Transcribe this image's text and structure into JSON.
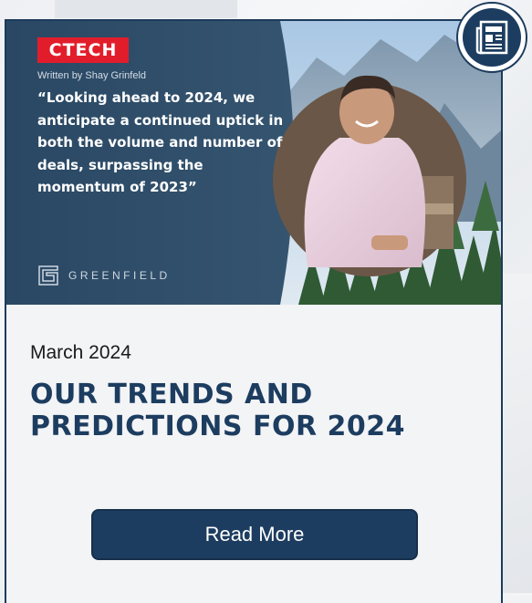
{
  "banner": {
    "logo_text": "CTECH",
    "byline": "Written by Shay Grinfeld",
    "quote": "“Looking ahead to 2024, we anticipate a continued uptick in both the volume and number of deals, surpassing the momentum of 2023”",
    "brand_name": "GREENFIELD"
  },
  "article": {
    "date": "March 2024",
    "title": "OUR TRENDS AND PREDICTIONS FOR 2024",
    "button_label": "Read More"
  },
  "colors": {
    "navy": "#1d3d60",
    "ctech_red": "#e21d2b",
    "banner_bg": "#2b4966"
  },
  "icons": {
    "badge": "newspaper-icon",
    "brand": "greenfield-logo-icon"
  }
}
